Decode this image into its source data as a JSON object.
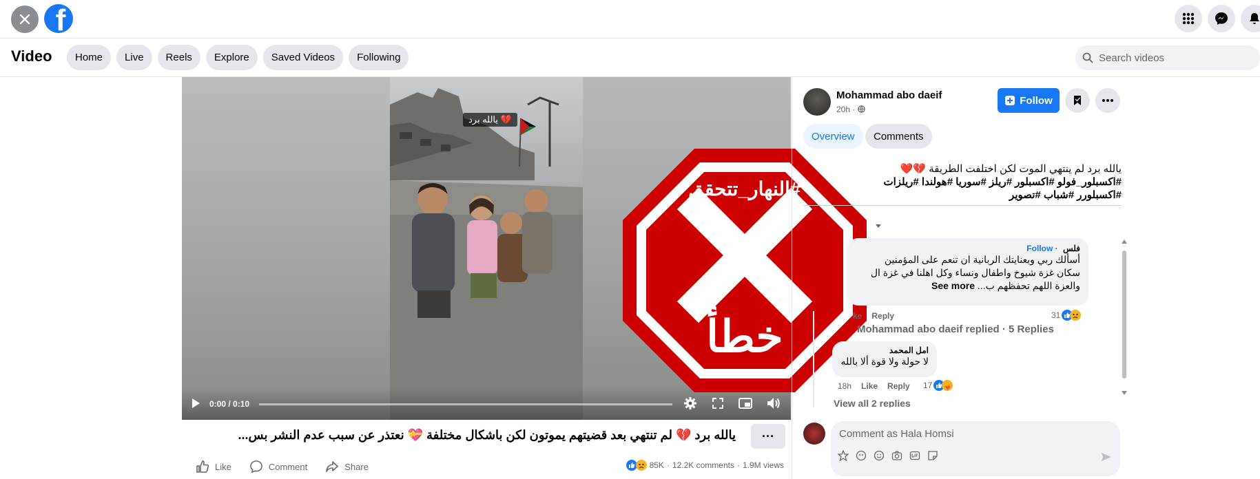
{
  "topbar": {
    "close_icon": "close-icon",
    "logo_letter": "f",
    "right_icons": [
      "apps-grid-icon",
      "messenger-icon",
      "notifications-icon"
    ]
  },
  "nav": {
    "title": "Video",
    "tabs": [
      "Home",
      "Live",
      "Reels",
      "Explore",
      "Saved Videos",
      "Following"
    ],
    "search_placeholder": "Search videos"
  },
  "video": {
    "overlay_caption": "يالله برد 💔",
    "time": "0:00 / 0:10",
    "progress_fraction": 0.0,
    "controls": [
      "play-icon",
      "settings-icon",
      "fullscreen-icon",
      "pip-icon",
      "volume-icon"
    ]
  },
  "stamp": {
    "hashtag": "#النهار_تتحقق",
    "mark": "X",
    "verdict": "خطأ",
    "color": "#cc0000"
  },
  "post": {
    "title": "يالله برد 💔 لم تنتهي بعد قضيتهم يموتون لكن باشكال مختلفة 💝 نعتذر عن سبب عدم النشر بس...",
    "more": "···",
    "actions": {
      "like": "Like",
      "comment": "Comment",
      "share": "Share"
    },
    "stats": {
      "reactions": "85K",
      "comments": "12.2K comments",
      "views": "1.9M views"
    }
  },
  "side": {
    "author": "Mohammad abo daeif",
    "time": "20h ·",
    "follow_label": "Follow",
    "tabs": {
      "overview": "Overview",
      "comments": "Comments"
    },
    "desc_line1": "يالله برد لم ينتهي الموت لكن اختلفت الطريقة 💔❤️",
    "desc_line2": "#اكسبلور_فولو #اكسبلور #ريلز #سوريا #هولندا #ريلزات",
    "desc_line3": "#اكسبلورر #شباب #تصوير",
    "comment1": {
      "author_fragment": "فلس",
      "follow": "· Follow",
      "line1": "أسألك ربي وبعنايتك الربانية ان تنعم على المؤمنين",
      "line2": "سكان غزة شيوخ واطفال ونساء وكل اهلنا في غزة ال",
      "line3": "والعزة اللهم تحفظهم ب...",
      "see_more": "See more",
      "like": "ke",
      "reply": "Reply",
      "reaction_count": "31"
    },
    "replied": "Mohammad abo daeif replied · 5 Replies",
    "comment2": {
      "author": "امل المحمد",
      "text": "لا حولة ولا قوة ألا بالله",
      "time": "18h",
      "like": "Like",
      "reply": "Reply",
      "reaction_count": "17"
    },
    "view_all": "View all 2 replies",
    "composer_placeholder": "Comment as Hala Homsi"
  },
  "colors": {
    "brand_blue": "#1877f2",
    "stamp_red": "#cc0000"
  }
}
